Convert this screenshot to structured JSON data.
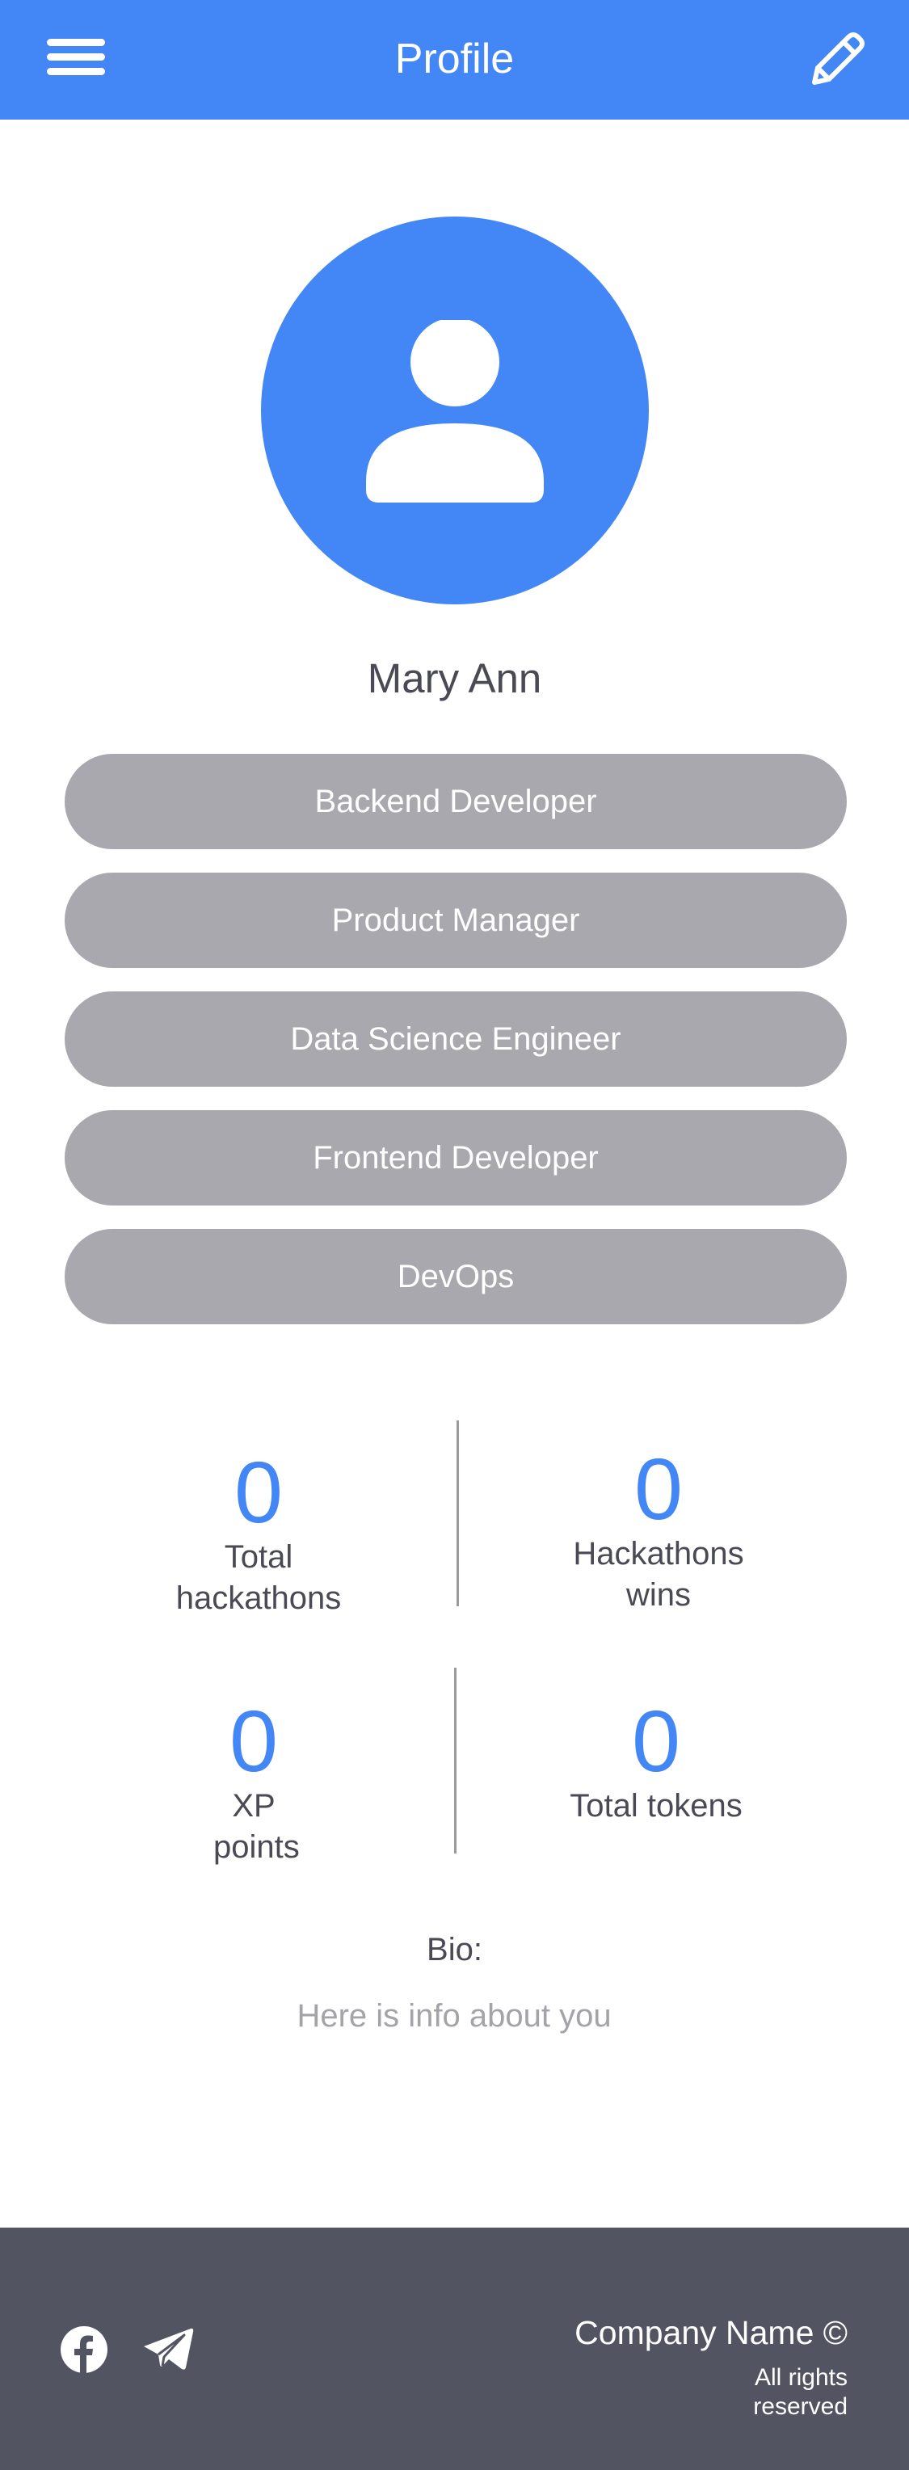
{
  "header": {
    "title": "Profile",
    "menu_icon": "hamburger-menu-icon",
    "edit_icon": "pencil-icon",
    "background_color": "#4287f5"
  },
  "profile": {
    "avatar_icon": "user-silhouette-icon",
    "name": "Mary Ann"
  },
  "roles": [
    "Backend Developer",
    "Product Manager",
    "Data Science Engineer",
    "Frontend Developer",
    "DevOps"
  ],
  "stats": {
    "total_hackathons": {
      "value": "0",
      "label": "Total hackathons"
    },
    "hackathon_wins": {
      "value": "0",
      "label": "Hackathons wins"
    },
    "xp_points": {
      "value": "0",
      "label": "XP points"
    },
    "total_tokens": {
      "value": "0",
      "label": "Total tokens"
    }
  },
  "bio": {
    "title": "Bio:",
    "text": "Here is info about you"
  },
  "footer": {
    "social_icons": [
      "facebook-icon",
      "telegram-icon"
    ],
    "company": "Company Name ©",
    "rights": "All rights reserved",
    "background_color": "#535461"
  },
  "colors": {
    "accent": "#4287f5",
    "pill": "#a8a8ae",
    "text": "#4a4a55",
    "muted": "#a3a3a8"
  }
}
